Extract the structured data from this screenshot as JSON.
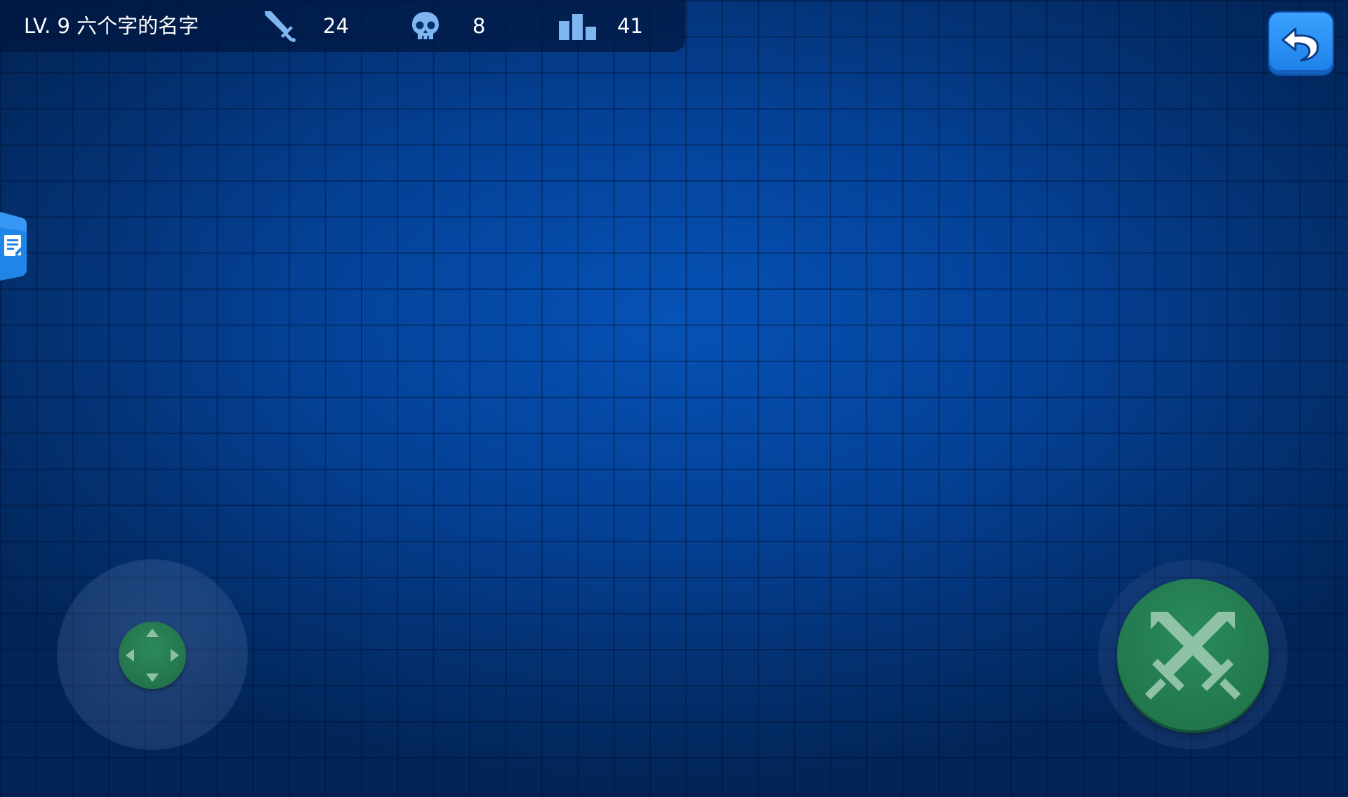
{
  "hud": {
    "player": {
      "label": "LV. 9 六个字的名字"
    },
    "stats": {
      "kills": "24",
      "deaths": "8",
      "rank": "41"
    },
    "icons": {
      "kills": "sword-icon",
      "deaths": "skull-icon",
      "rank": "leaderboard-bars-icon",
      "back": "return-arrow-icon",
      "side_tab": "notes-icon",
      "attack": "crossed-swords-icon",
      "joystick": "dpad-arrows-icon"
    }
  },
  "colors": {
    "background": "#0652b6",
    "grid_line": "#01143a",
    "stat_icon": "#7fb6f0",
    "back_button": "#2a8ff0",
    "action_green": "#2a8b5b",
    "text": "#ffffff"
  }
}
